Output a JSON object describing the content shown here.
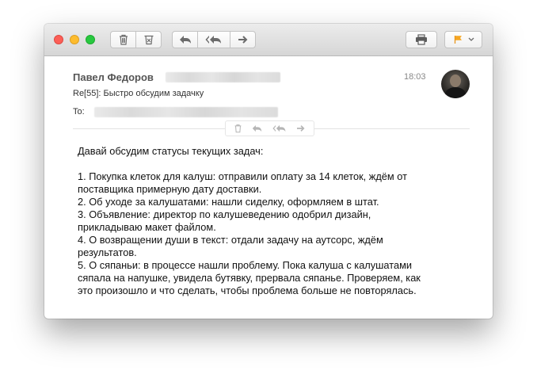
{
  "message": {
    "sender_name": "Павел Федоров",
    "time": "18:03",
    "subject": "Re[55]: Быстро обсудим задачку",
    "to_label": "To:"
  },
  "body": {
    "greeting": "Давай обсудим статусы текущих задач:",
    "lines": [
      "1. Покупка клеток для калуш: отправили оплату за 14 клеток, ждём от",
      "поставщика примерную дату доставки.",
      "2. Об уходе за калушатами: нашли сиделку, оформляем в штат.",
      "3. Объявление: директор по калушеведению одобрил дизайн,",
      "прикладываю макет файлом.",
      "4. О возвращении души в текст: отдали задачу на аутсорс, ждём",
      "результатов.",
      "5. О сяпаньи: в процессе нашли проблему. Пока калуша с калушатами",
      "сяпала на напушке, увидела бутявку, прервала сяпанье. Проверяем, как",
      "это произошло и что сделать, чтобы проблема больше не повторялась."
    ]
  },
  "toolbar": {
    "icons": [
      "trash-icon",
      "junk-icon",
      "reply-icon",
      "reply-all-icon",
      "forward-icon",
      "print-icon",
      "flag-icon"
    ],
    "flag_color": "#f5a623"
  },
  "colors": {
    "close": "#fc5f57",
    "minimize": "#fdbc2e",
    "maximize": "#28c840"
  }
}
